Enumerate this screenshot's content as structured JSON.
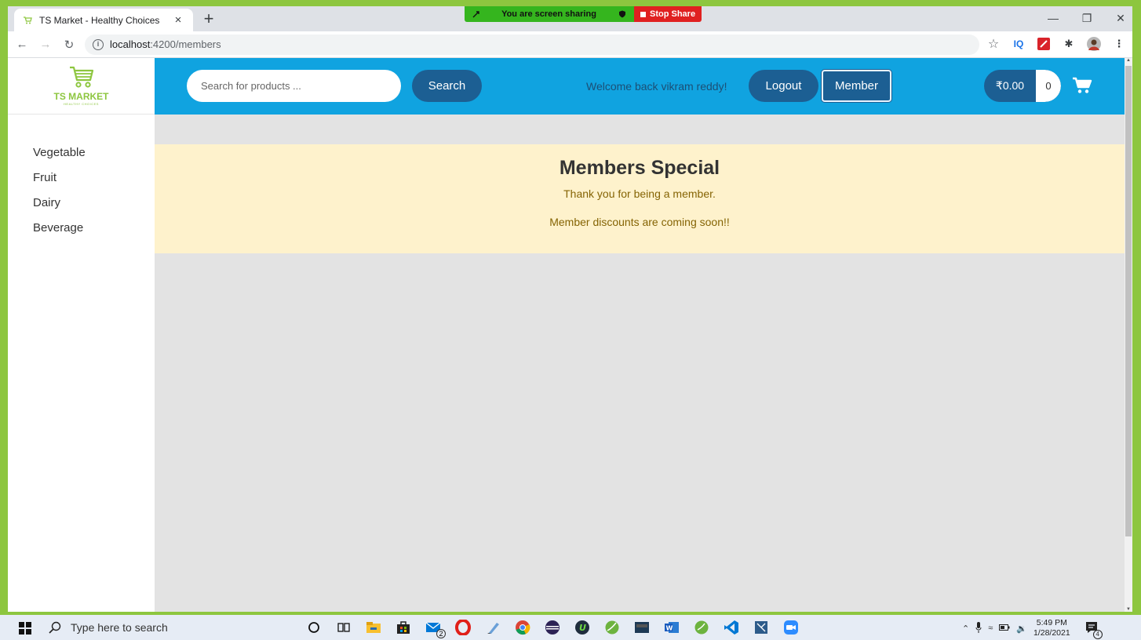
{
  "browser": {
    "tab_title": "TS Market - Healthy Choices",
    "tab_close": "×",
    "new_tab": "+",
    "url_host": "localhost",
    "url_path": ":4200/members",
    "share_text": "You are screen sharing",
    "stop_share": "Stop Share",
    "ext_iq": "IQ"
  },
  "header": {
    "logo_title": "TS MARKET",
    "logo_subtitle": "HEALTHY CHOICES",
    "search_placeholder": "Search for products ...",
    "search_button": "Search",
    "welcome": "Welcome back vikram reddy!",
    "logout_button": "Logout",
    "member_button": "Member",
    "cart_amount": "₹0.00",
    "cart_count": "0"
  },
  "sidebar": {
    "items": [
      {
        "label": "Vegetable"
      },
      {
        "label": "Fruit"
      },
      {
        "label": "Dairy"
      },
      {
        "label": "Beverage"
      }
    ]
  },
  "main": {
    "alert_title": "Members Special",
    "alert_line1": "Thank you for being a member.",
    "alert_line2": "Member discounts are coming soon!!"
  },
  "taskbar": {
    "search_placeholder": "Type here to search",
    "time": "5:49 PM",
    "date": "1/28/2021",
    "mail_badge": "2",
    "notif_badge": "4"
  },
  "colors": {
    "header_bg": "#10a3e0",
    "button_dark": "#1c5f93",
    "brand_green": "#8dc63f",
    "alert_bg": "#fef2cc"
  }
}
